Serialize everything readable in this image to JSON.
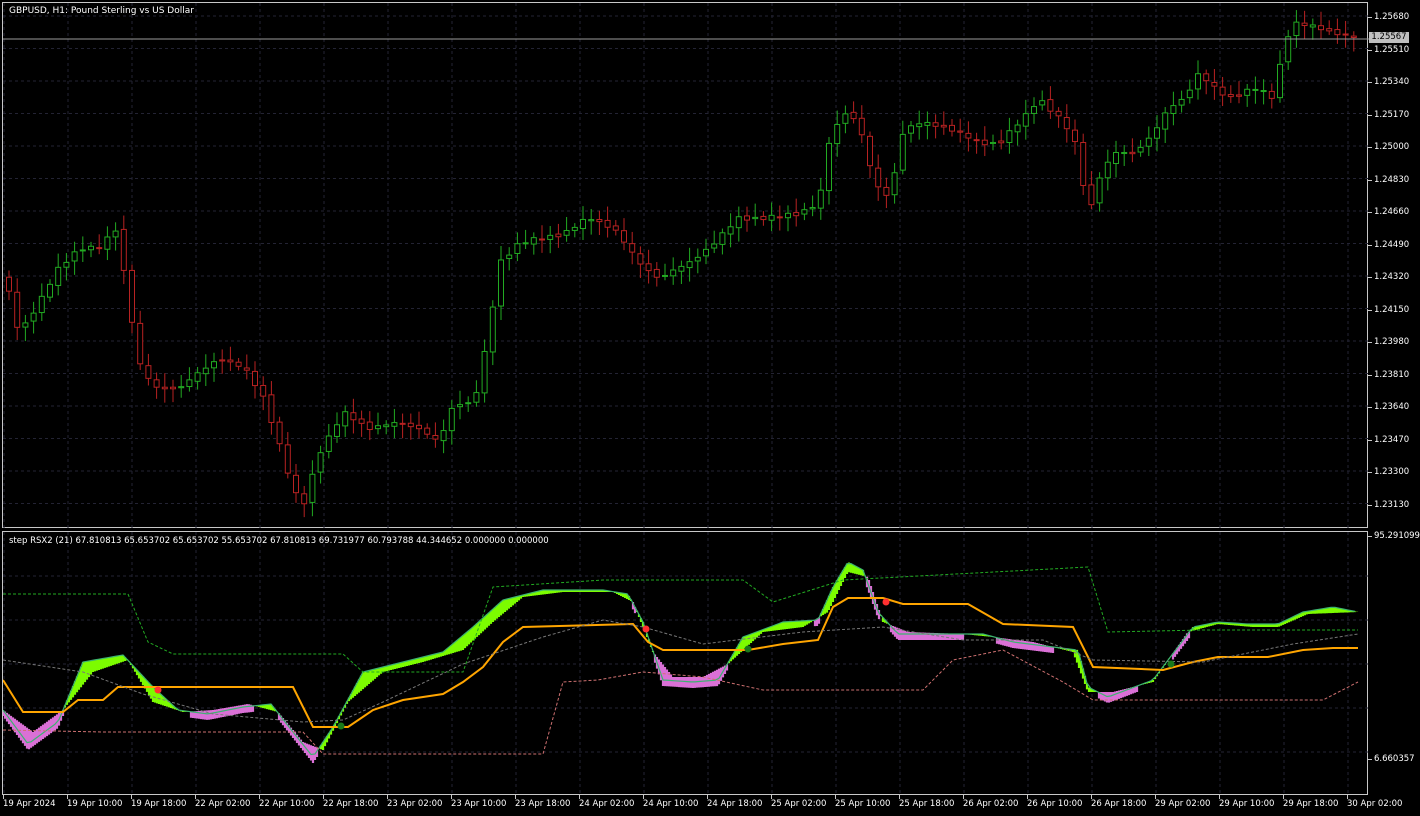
{
  "main_chart": {
    "title": "GBPUSD, H1:  Pound Sterling vs US Dollar",
    "current_price": "1.25567",
    "y_ticks": [
      "1.25680",
      "1.25510",
      "1.25340",
      "1.25170",
      "1.25000",
      "1.24830",
      "1.24660",
      "1.24490",
      "1.24320",
      "1.24150",
      "1.23980",
      "1.23810",
      "1.23640",
      "1.23470",
      "1.23300",
      "1.23130"
    ]
  },
  "indicator": {
    "title": "step RSX2 (21) 67.810813 65.653702 65.653702 55.653702 67.810813 69.731977 60.793788 44.344652 0.000000 0.000000",
    "y_max": "95.291099",
    "y_min": "6.660357"
  },
  "x_ticks": [
    "19 Apr 2024",
    "19 Apr 10:00",
    "19 Apr 18:00",
    "22 Apr 02:00",
    "22 Apr 10:00",
    "22 Apr 18:00",
    "23 Apr 02:00",
    "23 Apr 10:00",
    "23 Apr 18:00",
    "24 Apr 02:00",
    "24 Apr 10:00",
    "24 Apr 18:00",
    "25 Apr 02:00",
    "25 Apr 10:00",
    "25 Apr 18:00",
    "26 Apr 02:00",
    "26 Apr 10:00",
    "26 Apr 18:00",
    "29 Apr 02:00",
    "29 Apr 10:00",
    "29 Apr 18:00",
    "30 Apr 02:00"
  ],
  "colors": {
    "bull_candle": "#22aa22",
    "bear_candle": "#b82222",
    "grid": "#232333",
    "rsx_up": "#7cfc00",
    "rsx_down": "#da70d6",
    "step_line": "#ffa500"
  }
}
